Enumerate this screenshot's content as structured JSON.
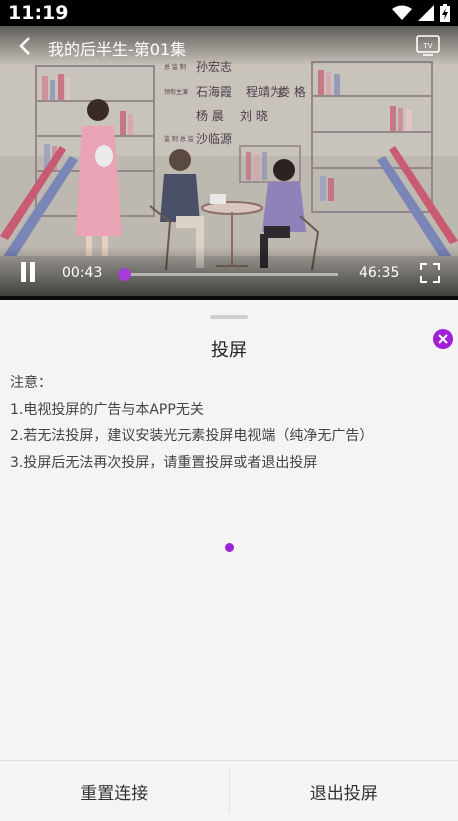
{
  "status_bar": {
    "time": "11:19",
    "icons": [
      "wifi-icon",
      "signal-icon",
      "battery-charging-icon"
    ]
  },
  "player": {
    "title": "我的后半生-第01集",
    "current_time": "00:43",
    "total_time": "46:35",
    "progress": 0.016,
    "accent_color": "#a53bd8",
    "credits": [
      "总 监 制",
      "孙宏志",
      "领衔主演",
      "石海霞",
      "程靖为",
      "娄 格",
      "杨 晨",
      "刘 晓",
      "监 制 总 监",
      "沙临源"
    ]
  },
  "cast_sheet": {
    "title": "投屏",
    "notes": [
      "注意：",
      "1.电视投屏的广告与本APP无关",
      "2.若无法投屏，建议安装光元素投屏电视端（纯净无广告）",
      "3.投屏后无法再次投屏，请重置投屏或者退出投屏"
    ],
    "accent_color": "#a020d8"
  },
  "actions": {
    "reset": "重置连接",
    "exit": "退出投屏"
  }
}
